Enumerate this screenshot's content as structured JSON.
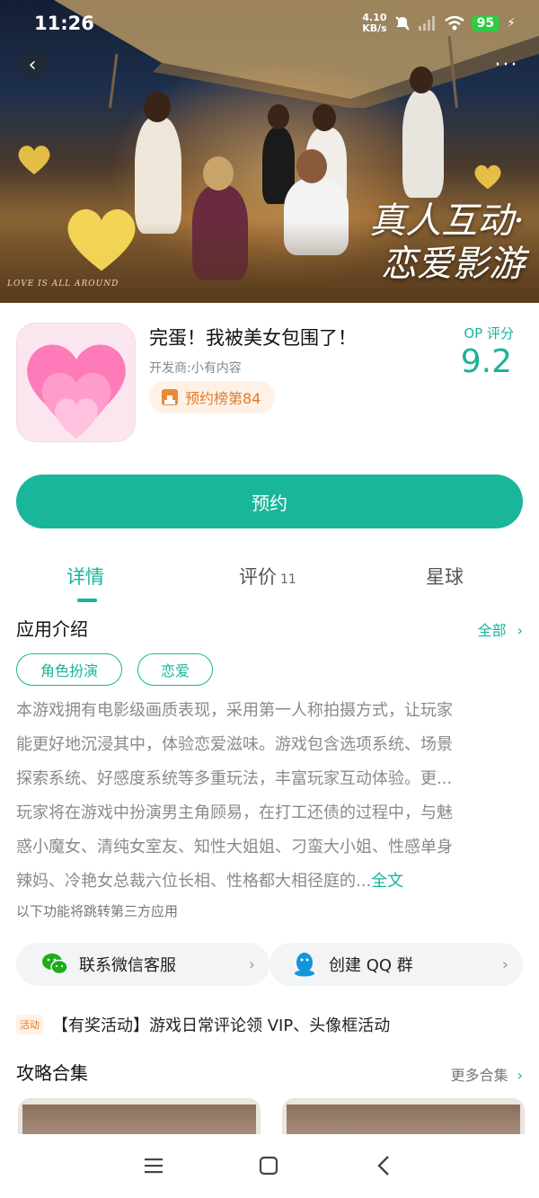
{
  "status_bar": {
    "time": "11:26",
    "net_speed_value": "4.10",
    "net_speed_unit": "KB/s",
    "battery": "95"
  },
  "hero": {
    "title_line1": "真人互动·",
    "title_line2": "恋爱影游",
    "caption": "LOVE IS ALL AROUND"
  },
  "app": {
    "name": "完蛋！我被美女包围了！",
    "developer": "开发商:小有内容",
    "rank_badge": "预约榜第84",
    "score_label": "OP 评分",
    "score": "9.2"
  },
  "reserve_button": "预约",
  "tabs": [
    {
      "label": "详情",
      "active": true
    },
    {
      "label": "评价",
      "count": "11",
      "active": false
    },
    {
      "label": "星球",
      "active": false
    }
  ],
  "intro": {
    "title": "应用介绍",
    "all_link": "全部",
    "tags": [
      "角色扮演",
      "恋爱"
    ],
    "paragraph1_lines": [
      "本游戏拥有电影级画质表现，采用第一人称拍摄方式，让玩家",
      "能更好地沉浸其中，体验恋爱滋味。游戏包含选项系统、场景",
      "探索系统、好感度系统等多重玩法，丰富玩家互动体验。更..."
    ],
    "paragraph2_lines": [
      "玩家将在游戏中扮演男主角顾易，在打工还债的过程中，与魅",
      "惑小魔女、清纯女室友、知性大姐姐、刁蛮大小姐、性感单身",
      "辣妈、冷艳女总裁六位长相、性格都大相径庭的..."
    ],
    "fulltext_link": "全文",
    "third_party_note": "以下功能将跳转第三方应用"
  },
  "services": [
    {
      "label": "联系微信客服",
      "icon": "wechat-icon"
    },
    {
      "label": "创建 QQ 群",
      "icon": "qq-icon"
    }
  ],
  "activity": {
    "badge": "活动",
    "text": "【有奖活动】游戏日常评论领 VIP、头像框活动"
  },
  "guides": {
    "title": "攻略合集",
    "more_link": "更多合集"
  },
  "colors": {
    "accent": "#1ab69b",
    "rank_orange": "#e07a2a"
  }
}
